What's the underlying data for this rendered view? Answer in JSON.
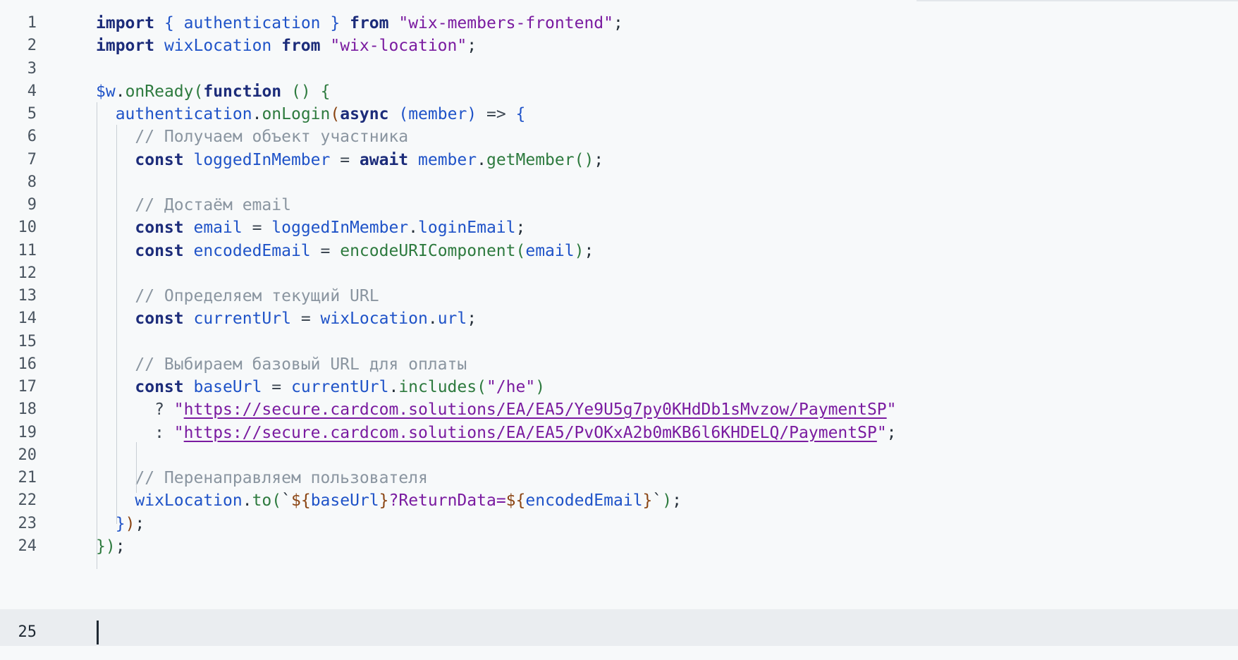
{
  "editor": {
    "active_line": "25",
    "lines": [
      {
        "n": "1",
        "tokens": [
          {
            "t": "import",
            "c": "kw"
          },
          {
            "t": " ",
            "c": "pl"
          },
          {
            "t": "{",
            "c": "pb"
          },
          {
            "t": " authentication ",
            "c": "id"
          },
          {
            "t": "}",
            "c": "pb"
          },
          {
            "t": " ",
            "c": "pl"
          },
          {
            "t": "from",
            "c": "kw"
          },
          {
            "t": " ",
            "c": "pl"
          },
          {
            "t": "\"wix-members-frontend\"",
            "c": "str"
          },
          {
            "t": ";",
            "c": "pl"
          }
        ]
      },
      {
        "n": "2",
        "tokens": [
          {
            "t": "import",
            "c": "kw"
          },
          {
            "t": " wixLocation ",
            "c": "id"
          },
          {
            "t": "from",
            "c": "kw"
          },
          {
            "t": " ",
            "c": "pl"
          },
          {
            "t": "\"wix-location\"",
            "c": "str"
          },
          {
            "t": ";",
            "c": "pl"
          }
        ]
      },
      {
        "n": "3",
        "tokens": []
      },
      {
        "n": "4",
        "tokens": [
          {
            "t": "$w",
            "c": "id"
          },
          {
            "t": ".",
            "c": "pl"
          },
          {
            "t": "onReady",
            "c": "fn"
          },
          {
            "t": "(",
            "c": "pc"
          },
          {
            "t": "function",
            "c": "kw"
          },
          {
            "t": " ",
            "c": "pl"
          },
          {
            "t": "()",
            "c": "pc"
          },
          {
            "t": " ",
            "c": "pl"
          },
          {
            "t": "{",
            "c": "pc"
          }
        ]
      },
      {
        "n": "5",
        "tokens": [
          {
            "t": "  ",
            "c": "pl"
          },
          {
            "t": "authentication",
            "c": "id"
          },
          {
            "t": ".",
            "c": "pl"
          },
          {
            "t": "onLogin",
            "c": "fn"
          },
          {
            "t": "(",
            "c": "tb"
          },
          {
            "t": "async",
            "c": "kw"
          },
          {
            "t": " ",
            "c": "pl"
          },
          {
            "t": "(",
            "c": "pb"
          },
          {
            "t": "member",
            "c": "id"
          },
          {
            "t": ")",
            "c": "pb"
          },
          {
            "t": " => ",
            "c": "op"
          },
          {
            "t": "{",
            "c": "pb"
          }
        ]
      },
      {
        "n": "6",
        "tokens": [
          {
            "t": "    ",
            "c": "pl"
          },
          {
            "t": "// Получаем объект участника",
            "c": "cm"
          }
        ]
      },
      {
        "n": "7",
        "tokens": [
          {
            "t": "    ",
            "c": "pl"
          },
          {
            "t": "const",
            "c": "kw"
          },
          {
            "t": " loggedInMember ",
            "c": "id"
          },
          {
            "t": "=",
            "c": "op"
          },
          {
            "t": " ",
            "c": "pl"
          },
          {
            "t": "await",
            "c": "kw"
          },
          {
            "t": " member",
            "c": "id"
          },
          {
            "t": ".",
            "c": "pl"
          },
          {
            "t": "getMember",
            "c": "fn"
          },
          {
            "t": "()",
            "c": "pc"
          },
          {
            "t": ";",
            "c": "pl"
          }
        ]
      },
      {
        "n": "8",
        "tokens": []
      },
      {
        "n": "9",
        "tokens": [
          {
            "t": "    ",
            "c": "pl"
          },
          {
            "t": "// Достаём email",
            "c": "cm"
          }
        ]
      },
      {
        "n": "10",
        "tokens": [
          {
            "t": "    ",
            "c": "pl"
          },
          {
            "t": "const",
            "c": "kw"
          },
          {
            "t": " email ",
            "c": "id"
          },
          {
            "t": "=",
            "c": "op"
          },
          {
            "t": " loggedInMember",
            "c": "id"
          },
          {
            "t": ".",
            "c": "pl"
          },
          {
            "t": "loginEmail",
            "c": "id"
          },
          {
            "t": ";",
            "c": "pl"
          }
        ]
      },
      {
        "n": "11",
        "tokens": [
          {
            "t": "    ",
            "c": "pl"
          },
          {
            "t": "const",
            "c": "kw"
          },
          {
            "t": " encodedEmail ",
            "c": "id"
          },
          {
            "t": "=",
            "c": "op"
          },
          {
            "t": " ",
            "c": "pl"
          },
          {
            "t": "encodeURIComponent",
            "c": "fn"
          },
          {
            "t": "(",
            "c": "pc"
          },
          {
            "t": "email",
            "c": "id"
          },
          {
            "t": ")",
            "c": "pc"
          },
          {
            "t": ";",
            "c": "pl"
          }
        ]
      },
      {
        "n": "12",
        "tokens": []
      },
      {
        "n": "13",
        "tokens": [
          {
            "t": "    ",
            "c": "pl"
          },
          {
            "t": "// Определяем текущий URL",
            "c": "cm"
          }
        ]
      },
      {
        "n": "14",
        "tokens": [
          {
            "t": "    ",
            "c": "pl"
          },
          {
            "t": "const",
            "c": "kw"
          },
          {
            "t": " currentUrl ",
            "c": "id"
          },
          {
            "t": "=",
            "c": "op"
          },
          {
            "t": " wixLocation",
            "c": "id"
          },
          {
            "t": ".",
            "c": "pl"
          },
          {
            "t": "url",
            "c": "id"
          },
          {
            "t": ";",
            "c": "pl"
          }
        ]
      },
      {
        "n": "15",
        "tokens": []
      },
      {
        "n": "16",
        "tokens": [
          {
            "t": "    ",
            "c": "pl"
          },
          {
            "t": "// Выбираем базовый URL для оплаты",
            "c": "cm"
          }
        ]
      },
      {
        "n": "17",
        "tokens": [
          {
            "t": "    ",
            "c": "pl"
          },
          {
            "t": "const",
            "c": "kw"
          },
          {
            "t": " baseUrl ",
            "c": "id"
          },
          {
            "t": "=",
            "c": "op"
          },
          {
            "t": " currentUrl",
            "c": "id"
          },
          {
            "t": ".",
            "c": "pl"
          },
          {
            "t": "includes",
            "c": "fn"
          },
          {
            "t": "(",
            "c": "pc"
          },
          {
            "t": "\"/he\"",
            "c": "str"
          },
          {
            "t": ")",
            "c": "pc"
          }
        ]
      },
      {
        "n": "18",
        "tokens": [
          {
            "t": "      ",
            "c": "pl"
          },
          {
            "t": "? ",
            "c": "op"
          },
          {
            "t": "\"",
            "c": "str"
          },
          {
            "t": "https://secure.cardcom.solutions/EA/EA5/Ye9U5g7py0KHdDb1sMvzow/PaymentSP",
            "c": "url"
          },
          {
            "t": "\"",
            "c": "str"
          }
        ]
      },
      {
        "n": "19",
        "tokens": [
          {
            "t": "      ",
            "c": "pl"
          },
          {
            "t": ": ",
            "c": "op"
          },
          {
            "t": "\"",
            "c": "str"
          },
          {
            "t": "https://secure.cardcom.solutions/EA/EA5/PvOKxA2b0mKB6l6KHDELQ/PaymentSP",
            "c": "url"
          },
          {
            "t": "\"",
            "c": "str"
          },
          {
            "t": ";",
            "c": "pl"
          }
        ]
      },
      {
        "n": "20",
        "tokens": []
      },
      {
        "n": "21",
        "tokens": [
          {
            "t": "    ",
            "c": "pl"
          },
          {
            "t": "// Перенаправляем пользователя",
            "c": "cm"
          }
        ]
      },
      {
        "n": "22",
        "tokens": [
          {
            "t": "    ",
            "c": "pl"
          },
          {
            "t": "wixLocation",
            "c": "id"
          },
          {
            "t": ".",
            "c": "pl"
          },
          {
            "t": "to",
            "c": "fn"
          },
          {
            "t": "(",
            "c": "pc"
          },
          {
            "t": "`",
            "c": "pl"
          },
          {
            "t": "${",
            "c": "tb"
          },
          {
            "t": "baseUrl",
            "c": "id"
          },
          {
            "t": "}",
            "c": "tb"
          },
          {
            "t": "?ReturnData=",
            "c": "tx"
          },
          {
            "t": "${",
            "c": "tb"
          },
          {
            "t": "encodedEmail",
            "c": "id"
          },
          {
            "t": "}",
            "c": "tb"
          },
          {
            "t": "`",
            "c": "pl"
          },
          {
            "t": ")",
            "c": "pc"
          },
          {
            "t": ";",
            "c": "pl"
          }
        ]
      },
      {
        "n": "23",
        "tokens": [
          {
            "t": "  ",
            "c": "pl"
          },
          {
            "t": "}",
            "c": "pb"
          },
          {
            "t": ")",
            "c": "tb"
          },
          {
            "t": ";",
            "c": "pl"
          }
        ]
      },
      {
        "n": "24",
        "tokens": [
          {
            "t": "}",
            "c": "pc"
          },
          {
            "t": ")",
            "c": "pc"
          },
          {
            "t": ";",
            "c": "pl"
          }
        ]
      },
      {
        "n": "25",
        "tokens": []
      }
    ]
  }
}
